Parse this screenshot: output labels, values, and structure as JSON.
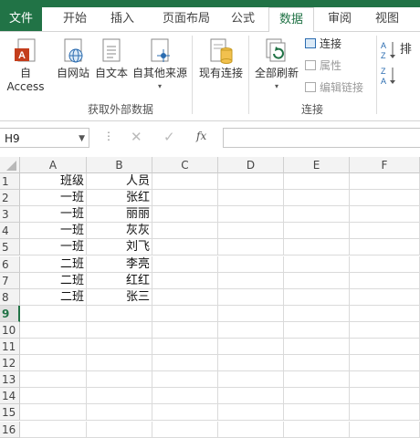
{
  "ribbon_tabs": [
    "文件",
    "开始",
    "插入",
    "页面布局",
    "公式",
    "数据",
    "审阅",
    "视图"
  ],
  "active_tab": "数据",
  "get_external": {
    "access": "自 Access",
    "web": "自网站",
    "text": "自文本",
    "other": "自其他来源",
    "existing": "现有连接",
    "group_label": "获取外部数据"
  },
  "connections": {
    "refresh_all": "全部刷新",
    "connections": "连接",
    "properties": "属性",
    "edit_links": "编辑链接",
    "group_label": "连接"
  },
  "sort": {
    "label": "排"
  },
  "name_box": "H9",
  "fx_symbol": "fx",
  "columns": [
    "A",
    "B",
    "C",
    "D",
    "E",
    "F"
  ],
  "rows": [
    [
      "班级",
      "人员"
    ],
    [
      "一班",
      "张红"
    ],
    [
      "一班",
      "丽丽"
    ],
    [
      "一班",
      "灰灰"
    ],
    [
      "一班",
      "刘飞"
    ],
    [
      "二班",
      "李亮"
    ],
    [
      "二班",
      "红红"
    ],
    [
      "二班",
      "张三"
    ]
  ],
  "row_numbers": [
    "1",
    "2",
    "3",
    "4",
    "5",
    "6",
    "7",
    "8",
    "9",
    "10",
    "11",
    "12",
    "13",
    "14",
    "15",
    "16"
  ],
  "selected_row": "9",
  "colors": {
    "excel_green": "#217346"
  }
}
